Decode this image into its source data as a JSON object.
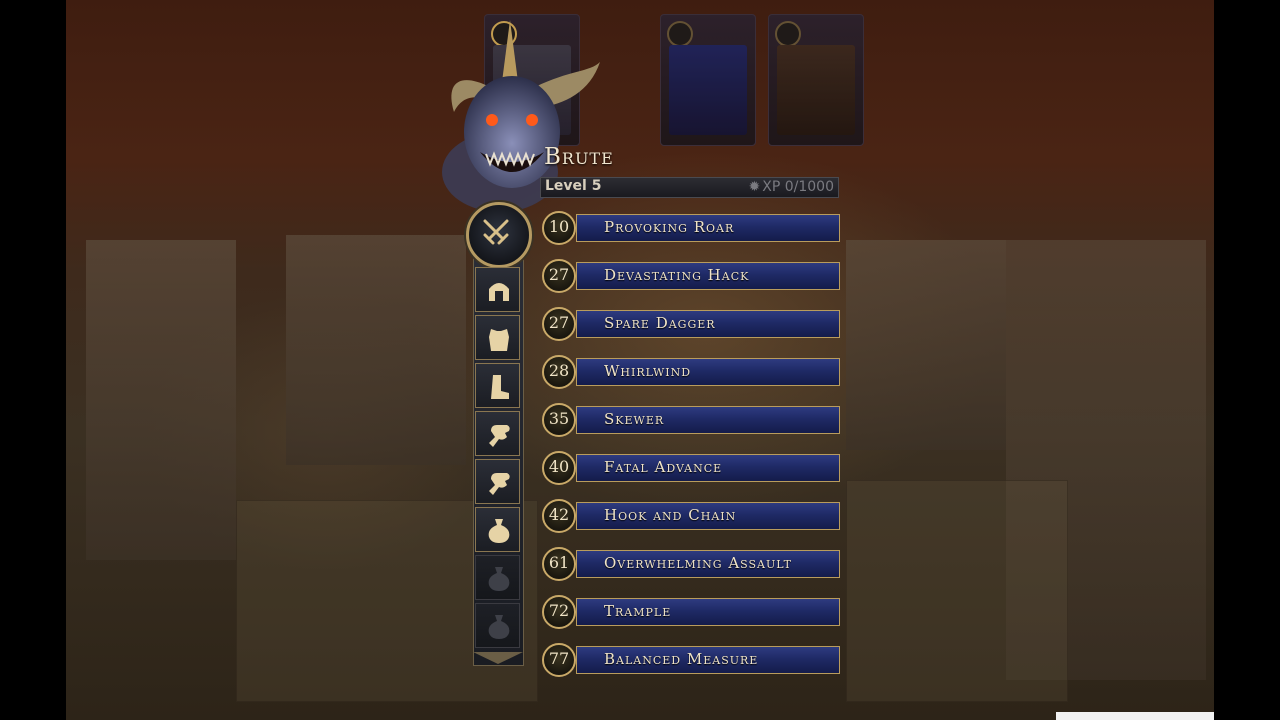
{
  "hero": {
    "name": "Brute",
    "level_label": "Level 5",
    "xp_label": "XP 0/1000",
    "xp_current": 0,
    "xp_max": 1000,
    "class_icon": "crossed-swords-icon"
  },
  "equipment_slots": [
    {
      "icon": "helmet-icon",
      "locked": false
    },
    {
      "icon": "chest-armor-icon",
      "locked": false
    },
    {
      "icon": "boots-icon",
      "locked": false
    },
    {
      "icon": "gauntlet-icon",
      "locked": false
    },
    {
      "icon": "gauntlet-icon",
      "locked": false
    },
    {
      "icon": "pouch-icon",
      "locked": false
    },
    {
      "icon": "pouch-icon",
      "locked": true
    },
    {
      "icon": "pouch-icon",
      "locked": true
    }
  ],
  "abilities": [
    {
      "cost": "10",
      "name": "Provoking Roar"
    },
    {
      "cost": "27",
      "name": "Devastating Hack"
    },
    {
      "cost": "27",
      "name": "Spare Dagger"
    },
    {
      "cost": "28",
      "name": "Whirlwind"
    },
    {
      "cost": "35",
      "name": "Skewer"
    },
    {
      "cost": "40",
      "name": "Fatal Advance"
    },
    {
      "cost": "42",
      "name": "Hook and Chain"
    },
    {
      "cost": "61",
      "name": "Overwhelming Assault"
    },
    {
      "cost": "72",
      "name": "Trample"
    },
    {
      "cost": "77",
      "name": "Balanced Measure"
    }
  ],
  "colors": {
    "ability_bar": "#1f2a66",
    "gold_trim": "#c9a968",
    "text": "#f0e4c8"
  }
}
